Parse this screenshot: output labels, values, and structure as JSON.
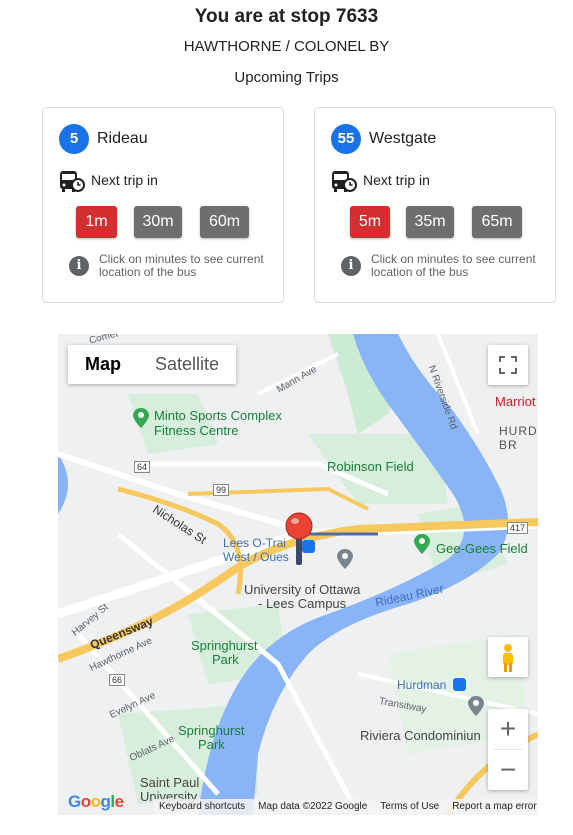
{
  "header": {
    "title": "You are at stop 7633",
    "stop_name": "HAWTHORNE / COLONEL BY",
    "upcoming": "Upcoming Trips"
  },
  "colors": {
    "route_badge": "#1a73e8",
    "first_trip": "#d32f2f",
    "later_trip": "#6e6e6e"
  },
  "routes": [
    {
      "number": "5",
      "name": "Rideau",
      "next_label": "Next trip in",
      "trips": [
        "1m",
        "30m",
        "60m"
      ],
      "info": "Click on minutes to see current location of the bus"
    },
    {
      "number": "55",
      "name": "Westgate",
      "next_label": "Next trip in",
      "trips": [
        "5m",
        "35m",
        "65m"
      ],
      "info": "Click on minutes to see current location of the bus"
    }
  ],
  "map": {
    "map_button": "Map",
    "satellite_button": "Satellite",
    "zoom_in": "+",
    "zoom_out": "−",
    "labels": {
      "minto1": "Minto Sports Complex",
      "minto2": "Fitness Centre",
      "robinson": "Robinson Field",
      "nicholas": "Nicholas St",
      "lees1": "Lees O-Trai",
      "lees2": "West / Oues",
      "uo1": "University of Ottawa",
      "uo2": "- Lees Campus",
      "geegees": "Gee-Gees Field",
      "rideau_river": "Rideau River",
      "queensway": "Queensway",
      "harvey": "Harvey St",
      "hawthorne": "Hawthorne Ave",
      "evelyn": "Evelyn Ave",
      "oblats": "Oblats Ave",
      "spring1a": "Springhurst",
      "spring1b": "Park",
      "spring2a": "Springhurst",
      "spring2b": "Park",
      "stpaul1": "Saint Paul",
      "stpaul2": "University",
      "hurdman": "Hurdman",
      "transitway": "Transitway",
      "riviera": "Riviera Condominiun",
      "mann": "Mann Ave",
      "nriverside": "N Riverside Rd",
      "marriott": "Marriot",
      "hurd1": "HURD",
      "hurd2": "BR",
      "hwy99": "99",
      "hwy64": "64",
      "hwy66": "66",
      "hwy417": "417",
      "comet": "Comet"
    },
    "attribution": {
      "logo": "Google",
      "shortcuts": "Keyboard shortcuts",
      "data": "Map data ©2022 Google",
      "terms": "Terms of Use",
      "report": "Report a map error"
    }
  }
}
